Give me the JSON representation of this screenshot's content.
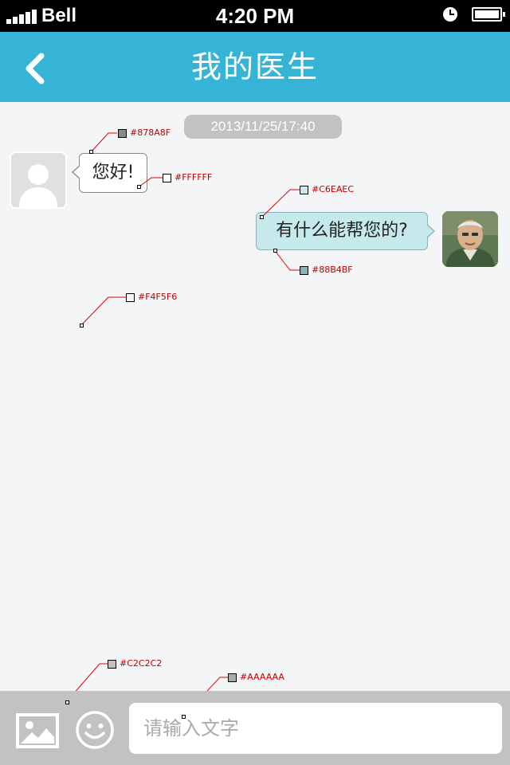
{
  "status_bar": {
    "carrier": "Bell",
    "time": "4:20 PM",
    "signal_bars": 5,
    "icons": [
      "signal-icon",
      "alarm-icon",
      "battery-icon"
    ]
  },
  "nav": {
    "title": "我的医生",
    "back_icon": "chevron-left-icon"
  },
  "chat": {
    "timestamp": "2013/11/25/17:40",
    "messages": [
      {
        "side": "left",
        "sender": "user",
        "text": "您好!"
      },
      {
        "side": "right",
        "sender": "doctor",
        "text": "有什么能帮您的?"
      }
    ]
  },
  "annotations": [
    {
      "label": "#878A8F"
    },
    {
      "label": "#FFFFFF"
    },
    {
      "label": "#C6EAEC"
    },
    {
      "label": "#88B4BF"
    },
    {
      "label": "#F4F5F6"
    },
    {
      "label": "#C2C2C2"
    },
    {
      "label": "#AAAAAA"
    }
  ],
  "input_bar": {
    "placeholder": "请输入文字",
    "value": "",
    "icons": [
      "image-icon",
      "emoji-icon"
    ]
  },
  "colors": {
    "nav_bg": "#36B4D6",
    "page_bg": "#F4F5F6",
    "left_bubble_bg": "#FFFFFF",
    "left_bubble_border": "#878A8F",
    "right_bubble_bg": "#C6EAEC",
    "right_bubble_border": "#88B4BF",
    "timestamp_bg": "#C2C2C2",
    "input_bar_bg": "#C2C2C2",
    "placeholder": "#AAAAAA",
    "annotation_text": "#C00000"
  }
}
